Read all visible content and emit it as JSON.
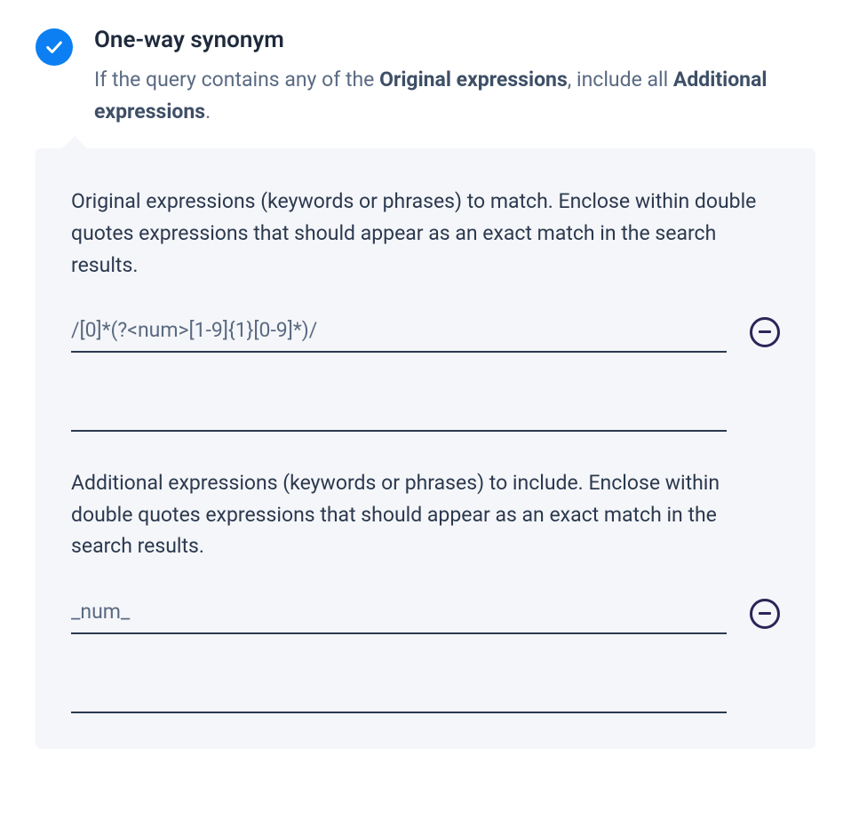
{
  "header": {
    "title": "One-way synonym",
    "description_prefix": "If the query contains any of the ",
    "description_bold1": "Original expressions",
    "description_middle": ", include all ",
    "description_bold2": "Additional expressions",
    "description_suffix": "."
  },
  "panel": {
    "original": {
      "label": "Original expressions (keywords or phrases) to match. Enclose within double quotes expressions that should appear as an exact match in the search results.",
      "inputs": [
        {
          "value": "/[0]*(?<num>[1-9]{1}[0-9]*)/"
        },
        {
          "value": ""
        }
      ]
    },
    "additional": {
      "label": "Additional expressions (keywords or phrases) to include. Enclose within double quotes expressions that should appear as an exact match in the search results.",
      "inputs": [
        {
          "value": "_num_"
        },
        {
          "value": ""
        }
      ]
    }
  },
  "icons": {
    "check": "check-icon",
    "remove": "remove-icon"
  }
}
